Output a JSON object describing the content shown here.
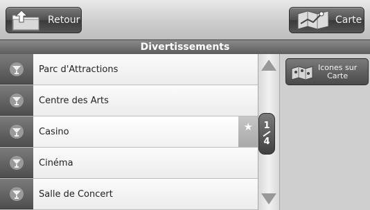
{
  "header": {
    "back_label": "Retour",
    "map_label": "Carte"
  },
  "title": "Divertissements",
  "list": [
    {
      "label": "Parc d'Attractions"
    },
    {
      "label": "Centre des Arts"
    },
    {
      "label": "Casino"
    },
    {
      "label": "Cinéma"
    },
    {
      "label": "Salle de Concert"
    }
  ],
  "pager": {
    "current": "1",
    "total": "4"
  },
  "side": {
    "icons_on_map_label_line1": "Icones sur",
    "icons_on_map_label_line2": "Carte"
  },
  "icons": {
    "back": "folder-back-icon",
    "map": "map-icon",
    "entertainment": "cocktail-icon",
    "favorite": "star-icon"
  }
}
